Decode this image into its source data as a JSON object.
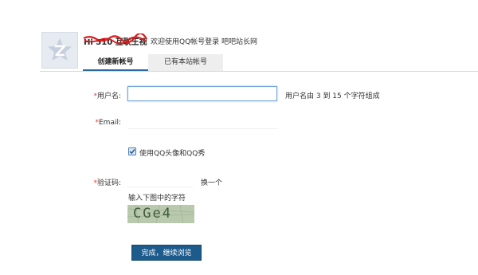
{
  "header": {
    "avatar_icon": "qzone-star-icon",
    "username": "Hi 510 互联王视",
    "welcome": "欢迎使用QQ帐号登录 吧吧站长网"
  },
  "tabs": [
    {
      "label": "创建新帐号",
      "active": true
    },
    {
      "label": "已有本站帐号",
      "active": false
    }
  ],
  "form": {
    "username": {
      "required_mark": "*",
      "label": "用户名:",
      "value": "",
      "hint": "用户名由 3 到 15 个字符组成"
    },
    "email": {
      "required_mark": "*",
      "label": "Email:",
      "value": ""
    },
    "use_qq_avatar": {
      "checked": true,
      "label": "使用QQ头像和QQ秀"
    },
    "captcha": {
      "required_mark": "*",
      "label": "验证码:",
      "value": "",
      "refresh_label": "换一个",
      "prompt": "输入下图中的字符",
      "image_text": "CGe4"
    },
    "submit_label": "完成，继续浏览"
  },
  "colors": {
    "accent": "#1c5b8c",
    "required": "#ee3333",
    "focus_border": "#6ea6d8",
    "tab_underline": "#2b6aa0"
  }
}
